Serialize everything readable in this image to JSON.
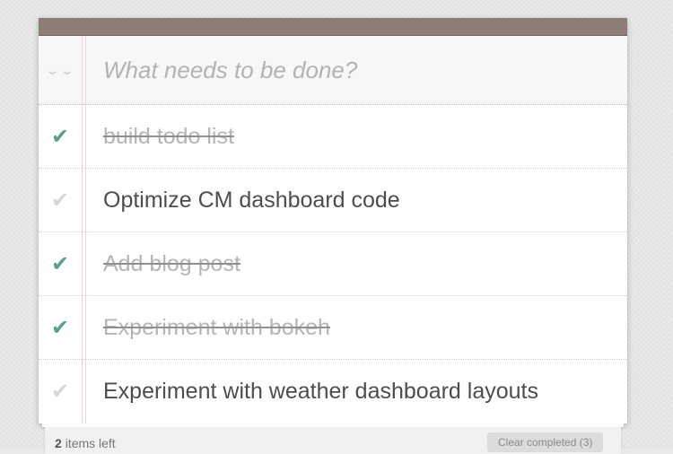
{
  "header": {
    "toggle_all_icon": "double-chevron-down-icon",
    "toggle_all_glyph": "⌄⌄",
    "new_todo_placeholder": "What needs to be done?",
    "new_todo_value": ""
  },
  "todos": [
    {
      "label": "build todo list",
      "completed": true,
      "check_glyph": "✔"
    },
    {
      "label": "Optimize CM dashboard code",
      "completed": false,
      "check_glyph": "✔"
    },
    {
      "label": "Add blog post",
      "completed": true,
      "check_glyph": "✔"
    },
    {
      "label": "Experiment with bokeh",
      "completed": true,
      "check_glyph": "✔"
    },
    {
      "label": "Experiment with weather dashboard layouts",
      "completed": false,
      "check_glyph": "✔"
    }
  ],
  "footer": {
    "count": "2",
    "count_suffix": "items left",
    "clear_label": "Clear completed (3)"
  },
  "colors": {
    "topbar": "#8d7d77",
    "check_done": "#5e9c8f",
    "check_open": "#d6d6d6",
    "completed_text": "#b5b5b5"
  }
}
